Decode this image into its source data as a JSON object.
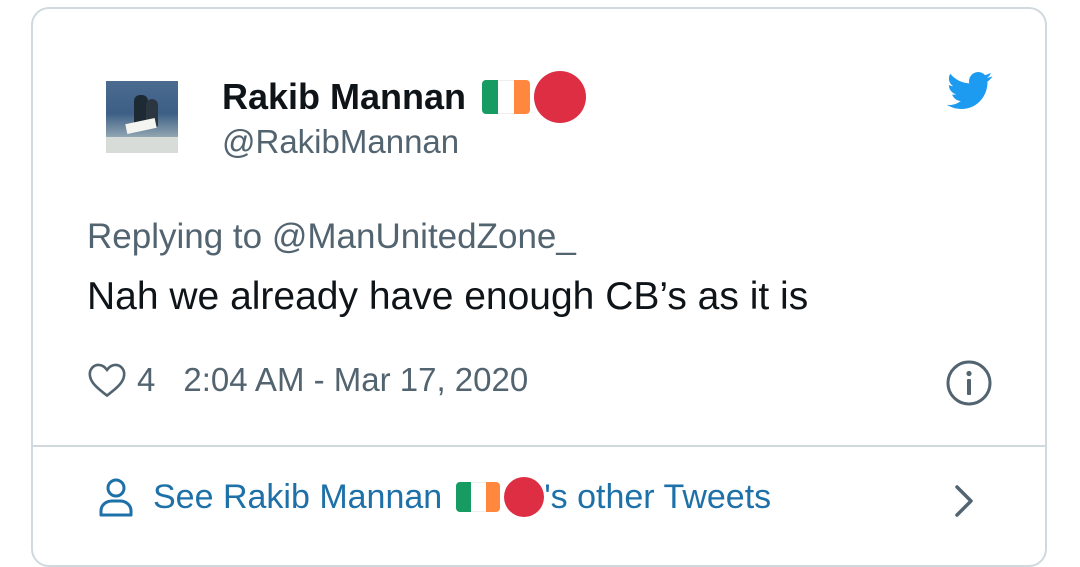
{
  "tweet": {
    "display_name": "Rakib Mannan",
    "handle": "@RakibMannan",
    "replying_to": "Replying to @ManUnitedZone_",
    "text": "Nah we already have enough CB’s as it is",
    "likes": "4",
    "timestamp": "2:04 AM - Mar 17, 2020"
  },
  "footer": {
    "prefix": "See Rakib Mannan",
    "suffix": "'s other Tweets"
  },
  "icons": {
    "brand": "twitter-bird-icon",
    "like": "heart-icon",
    "info": "info-icon",
    "profile": "person-icon",
    "more": "chevron-right-icon",
    "name_emoji": [
      "ireland-flag-icon",
      "red-circle-icon"
    ]
  },
  "colors": {
    "twitter_blue": "#1d9bf0",
    "link_blue": "#1d70a8",
    "muted_text": "#536471",
    "border": "#cfd9de",
    "flag_green": "#169b62",
    "flag_orange": "#ff883e",
    "red_circle": "#dd2e44"
  }
}
